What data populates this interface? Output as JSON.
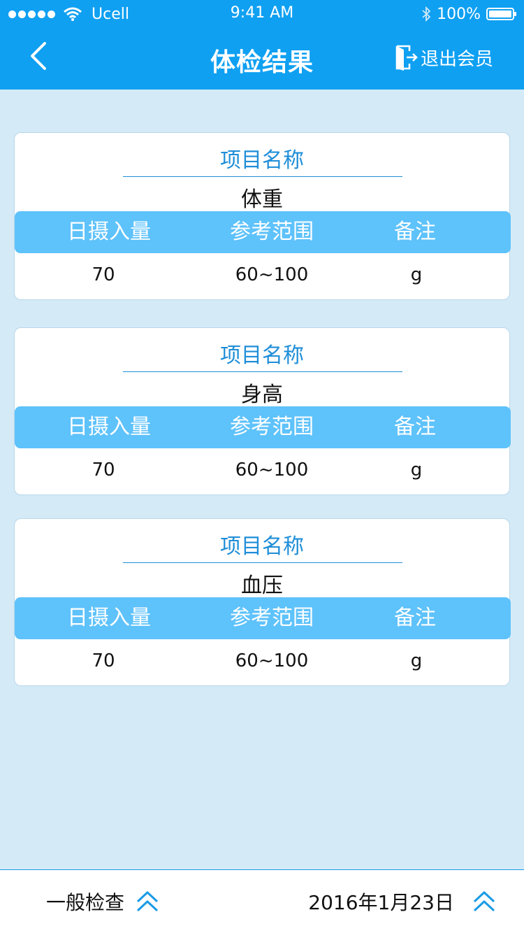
{
  "status_bar": {
    "carrier": "Ucell",
    "time": "9:41 AM",
    "battery": "100%"
  },
  "nav": {
    "title": "体检结果",
    "logout_label": "退出会员"
  },
  "cards": [
    {
      "title": "项目名称",
      "name": "体重",
      "headers": [
        "日摄入量",
        "参考范围",
        "备注"
      ],
      "values": [
        "70",
        "60~100",
        "g"
      ]
    },
    {
      "title": "项目名称",
      "name": "身高",
      "headers": [
        "日摄入量",
        "参考范围",
        "备注"
      ],
      "values": [
        "70",
        "60~100",
        "g"
      ]
    },
    {
      "title": "项目名称",
      "name": "血压",
      "headers": [
        "日摄入量",
        "参考范围",
        "备注"
      ],
      "values": [
        "70",
        "60~100",
        "g"
      ]
    }
  ],
  "bottom_bar": {
    "category": "一般检查",
    "date": "2016年1月23日"
  },
  "colors": {
    "header_bg": "#0fa0f2",
    "page_bg": "#d4eaf7",
    "table_header_bg": "#5ec2fb",
    "accent": "#1f8ed8"
  },
  "icons": {
    "back": "chevron-left-icon",
    "logout": "exit-door-icon",
    "expand": "double-chevron-up-icon"
  }
}
